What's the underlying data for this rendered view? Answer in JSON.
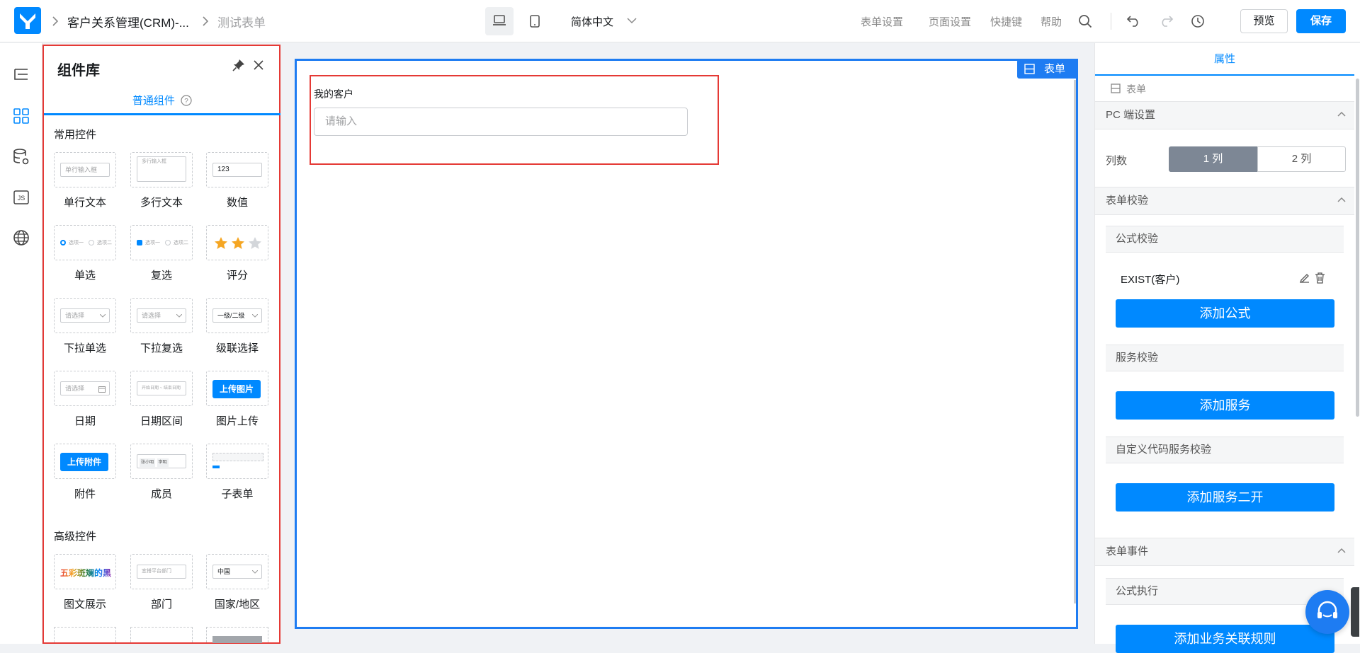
{
  "breadcrumb": {
    "app": "客户关系管理(CRM)-...",
    "form": "测试表单"
  },
  "topbar": {
    "language": "简体中文",
    "form_settings": "表单设置",
    "page_settings": "页面设置",
    "shortcuts": "快捷键",
    "help": "帮助",
    "preview": "预览",
    "save": "保存"
  },
  "library": {
    "title": "组件库",
    "tab": "普通组件",
    "basic_section": "常用控件",
    "advanced_section": "高级控件",
    "components": [
      "单行文本",
      "多行文本",
      "数值",
      "单选",
      "复选",
      "评分",
      "下拉单选",
      "下拉复选",
      "级联选择",
      "日期",
      "日期区间",
      "图片上传",
      "附件",
      "成员",
      "子表单"
    ],
    "advanced": [
      "图文展示",
      "部门",
      "国家/地区"
    ],
    "thumbs": {
      "single_line": "单行输入框",
      "multi_line": "多行输入框",
      "number": "123",
      "radio_a": "选项一",
      "radio_b": "选项二",
      "check_a": "选项一",
      "check_b": "选项二",
      "select": "请选择",
      "multi_select": "请选择",
      "cascade": "一级/二级",
      "date": "请选择",
      "range_a": "开始日期",
      "range_b": "结束日期",
      "upload_image": "上传图片",
      "upload_file": "上传附件",
      "member_a": "张小明",
      "member_b": "李明",
      "richtext": "五彩斑斓的黑",
      "dept": "宜搭平台部门",
      "country": "中国"
    },
    "rating": {
      "value": 2,
      "max": 3
    }
  },
  "canvas": {
    "badge": "表单",
    "field_label": "我的客户",
    "field_placeholder": "请输入"
  },
  "props": {
    "tab": "属性",
    "breadcrumb": "表单",
    "pc_settings": "PC 端设置",
    "columns_label": "列数",
    "col1": "1 列",
    "col2": "2 列",
    "validation": "表单校验",
    "formula_validation": "公式校验",
    "formula_item": "EXIST(客户)",
    "add_formula": "添加公式",
    "service_validation": "服务校验",
    "add_service": "添加服务",
    "custom_validation": "自定义代码服务校验",
    "add_service_dev": "添加服务二开",
    "events": "表单事件",
    "formula_exec": "公式执行",
    "add_rule": "添加业务关联规则"
  },
  "colors": {
    "primary": "#0089ff",
    "highlight": "#e53935",
    "canvas_border": "#1e7cf2",
    "active_col": "#7d8795"
  }
}
